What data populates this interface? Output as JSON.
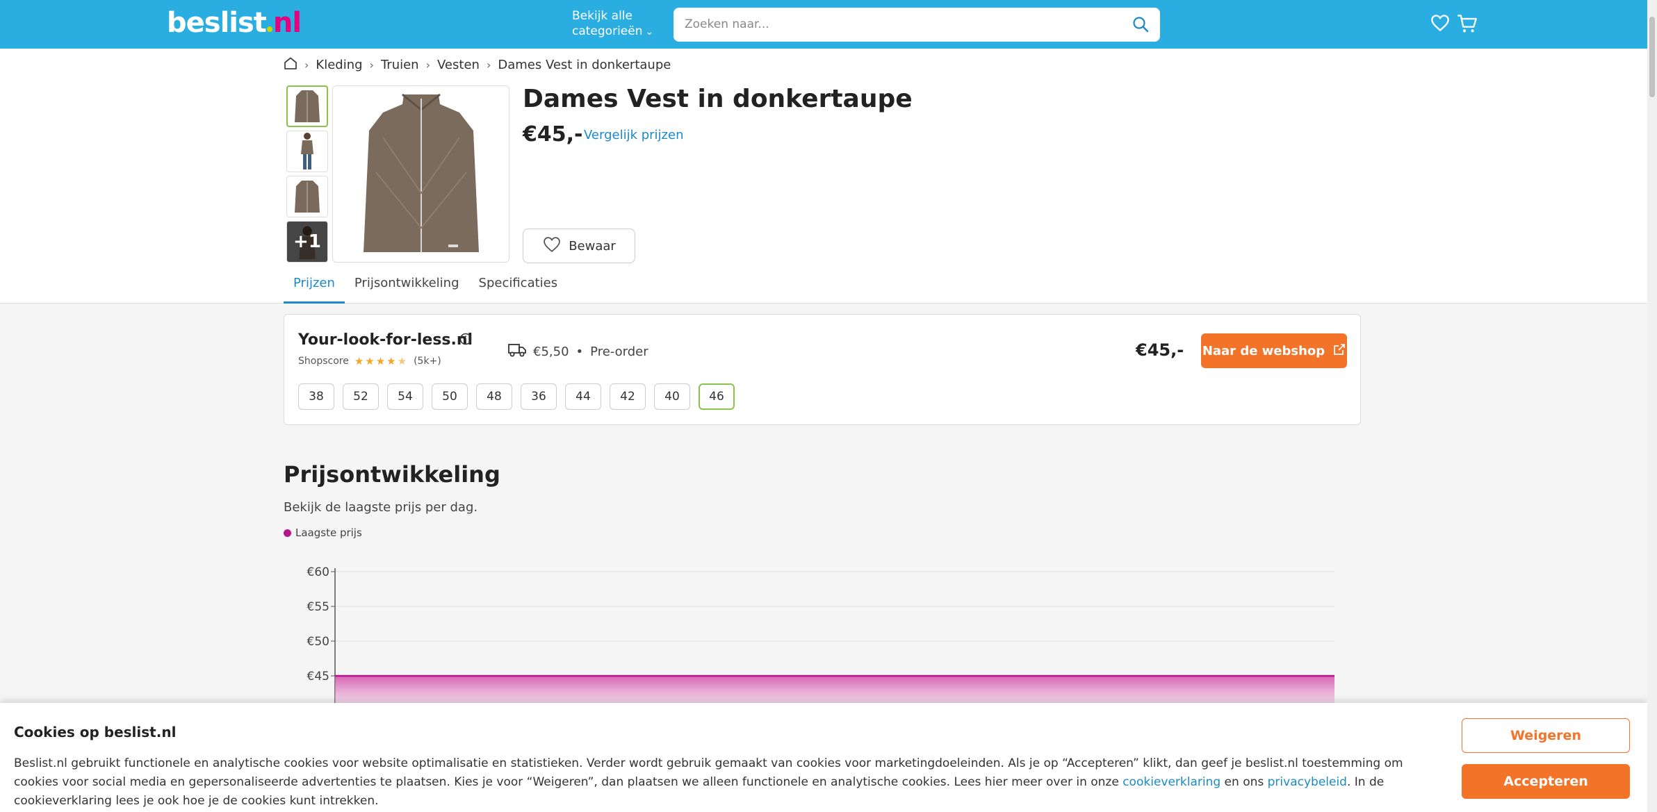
{
  "header": {
    "logo_main": "beslist",
    "logo_tld": "nl",
    "categories_line1": "Bekijk alle",
    "categories_line2": "categorieën",
    "search_placeholder": "Zoeken naar..."
  },
  "breadcrumb": [
    "Kleding",
    "Truien",
    "Vesten",
    "Dames Vest in donkertaupe"
  ],
  "product": {
    "title": "Dames Vest in donkertaupe",
    "price": "€45,-",
    "compare_link": "Vergelijk prijzen",
    "more_images": "+1",
    "save_label": "Bewaar"
  },
  "tabs": [
    "Prijzen",
    "Prijsontwikkeling",
    "Specificaties"
  ],
  "offer": {
    "shop_name": "Your-look-for-less.nl",
    "shopscore_label": "Shopscore",
    "rating_count": "(5k+)",
    "rating": 4.5,
    "shipping": "€5,50",
    "bullet": "•",
    "availability": "Pre-order",
    "price": "€45,-",
    "button": "Naar de webshop",
    "sizes": [
      "38",
      "52",
      "54",
      "50",
      "48",
      "36",
      "44",
      "42",
      "40",
      "46"
    ],
    "selected_size": "46"
  },
  "price_history": {
    "title": "Prijsontwikkeling",
    "subtitle": "Bekijk de laagste prijs per dag.",
    "legend": "Laagste prijs"
  },
  "chart_data": {
    "type": "area",
    "series": [
      {
        "name": "Laagste prijs",
        "values": [
          45,
          45
        ]
      }
    ],
    "y_ticks": [
      "€60",
      "€55",
      "€50",
      "€45"
    ],
    "ylim_visible": [
      45,
      60
    ],
    "color": "#b4178a"
  },
  "cookie": {
    "title": "Cookies op beslist.nl",
    "text_1": "Beslist.nl gebruikt functionele en analytische cookies voor website optimalisatie en statistieken. Verder wordt gebruik gemaakt van cookies voor marketingdoeleinden. Als je op “Accepteren” klikt, dan geef je beslist.nl toestemming om cookies voor social media en gepersonaliseerde advertenties te plaatsen. Kies je voor “Weigeren”, dan plaatsen we alleen functionele en analytische cookies. Lees hier meer over in onze ",
    "link_1": "cookieverklaring",
    "text_2": " en ons ",
    "link_2": "privacybeleid",
    "text_3": ". In de cookieverklaring lees je ook hoe je de cookies kunt intrekken.",
    "reject": "Weigeren",
    "accept": "Accepteren"
  },
  "colors": {
    "brand_blue": "#2aaee2",
    "accent_orange": "#f37429",
    "link_blue": "#1a8ac9",
    "chart_magenta": "#b4178a"
  }
}
